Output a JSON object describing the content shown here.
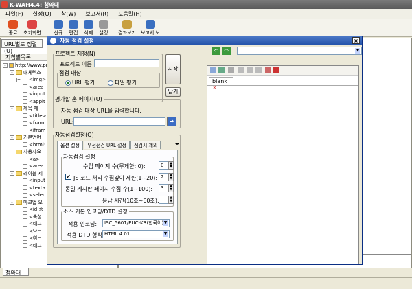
{
  "app": {
    "title": "K-WAH4.4: 청와대"
  },
  "menu": [
    "파일(F)",
    "설정(O)",
    "창(W)",
    "보고서(R)",
    "도움말(H)"
  ],
  "toolbar": [
    {
      "label": "종료",
      "icon": "exit-icon",
      "color": "#e05020"
    },
    {
      "label": "초기화면",
      "icon": "home-icon",
      "color": "#d44"
    },
    {
      "label": "신규",
      "icon": "new-icon",
      "color": "#3a6fc0"
    },
    {
      "label": "편집",
      "icon": "edit-icon",
      "color": "#3a6fc0"
    },
    {
      "label": "삭제",
      "icon": "delete-icon",
      "color": "#3a6fc0"
    },
    {
      "label": "설정",
      "icon": "settings-icon",
      "color": "#999"
    },
    {
      "label": "결과보기",
      "icon": "clipboard-icon",
      "color": "#c8a040"
    },
    {
      "label": "보고서 보기",
      "icon": "report-icon",
      "color": "#3a6fc0"
    }
  ],
  "left": {
    "tab": "URL별로 정렬(U)",
    "header": "지침별목록",
    "tree": [
      {
        "d": 0,
        "t": "http://www.pr",
        "type": "root",
        "e": "-"
      },
      {
        "d": 1,
        "t": "대체텍스",
        "type": "folder",
        "e": "-"
      },
      {
        "d": 2,
        "t": "<img>",
        "type": "tag",
        "e": "+"
      },
      {
        "d": 2,
        "t": "<area",
        "type": "tag",
        "e": ""
      },
      {
        "d": 2,
        "t": "<input",
        "type": "tag",
        "e": ""
      },
      {
        "d": 2,
        "t": "<applt",
        "type": "tag",
        "e": ""
      },
      {
        "d": 1,
        "t": "제목 제",
        "type": "folder",
        "e": "-"
      },
      {
        "d": 2,
        "t": "<title>",
        "type": "tag",
        "e": ""
      },
      {
        "d": 2,
        "t": "<fram",
        "type": "tag",
        "e": ""
      },
      {
        "d": 2,
        "t": "<ifram",
        "type": "tag",
        "e": ""
      },
      {
        "d": 1,
        "t": "기본언어",
        "type": "folder",
        "e": "-"
      },
      {
        "d": 2,
        "t": "<html:",
        "type": "tag",
        "e": ""
      },
      {
        "d": 1,
        "t": "사용자요",
        "type": "folder",
        "e": "-"
      },
      {
        "d": 2,
        "t": "<a>",
        "type": "tag",
        "e": ""
      },
      {
        "d": 2,
        "t": "<area",
        "type": "tag",
        "e": ""
      },
      {
        "d": 1,
        "t": "레이블 제",
        "type": "folder",
        "e": "-"
      },
      {
        "d": 2,
        "t": "<input",
        "type": "tag",
        "e": ""
      },
      {
        "d": 2,
        "t": "<texta",
        "type": "tag",
        "e": ""
      },
      {
        "d": 2,
        "t": "<selec",
        "type": "tag",
        "e": ""
      },
      {
        "d": 1,
        "t": "마크업 오",
        "type": "folder",
        "e": "-"
      },
      {
        "d": 2,
        "t": "<id 중",
        "type": "tag",
        "e": ""
      },
      {
        "d": 2,
        "t": "<속성",
        "type": "tag",
        "e": ""
      },
      {
        "d": 2,
        "t": "<태그",
        "type": "tag",
        "e": ""
      },
      {
        "d": 2,
        "t": "<닫는",
        "type": "tag",
        "e": ""
      },
      {
        "d": 2,
        "t": "<여는",
        "type": "tag",
        "e": ""
      },
      {
        "d": 2,
        "t": "<태그",
        "type": "tag",
        "e": ""
      }
    ]
  },
  "statustab": "청와대",
  "dialog": {
    "title": "자동 점검 설정",
    "project_legend": "프로젝트 지정(N)",
    "project_name_label": "프로젝트 이름",
    "project_name_value": "",
    "target_legend": "점검 대상",
    "radio_url": "URL 평가",
    "radio_file": "파일 평가",
    "start_btn": "시작",
    "close_btn": "닫기",
    "home_legend": "평가할 홈 페이지(U)",
    "home_desc": "자동 점검 대상 URL을 입력합니다.",
    "url_label": "URL:",
    "url_value": "",
    "auto_legend": "자동점검설정(O)",
    "tabs": [
      "옵션 설정",
      "우선점검 URL 설정",
      "점검시 제외"
    ],
    "auto_sub_legend": "자동점검 설정",
    "max_pages_label": "수집 페이지 수(무제한: 0):",
    "max_pages_value": "0",
    "js_label": "JS 코드 처리 수집깊이 제한(1~20):",
    "js_value": "2",
    "js_checked": true,
    "board_label": "동일 게시판 페이지 수집 수(1~100):",
    "board_value": "3",
    "timeout_label": "응답 시간(10초~60초):",
    "timeout_value": "",
    "enc_legend": "소스 기본 인코딩/DTD 설정",
    "enc_label": "적용 인코딩:",
    "enc_value": "ISC_5601/EUC-KR(한국어)",
    "dtd_label": "적용 DTD 형식:",
    "dtd_value": "HTML 4.01",
    "blank_tab": "blank"
  }
}
